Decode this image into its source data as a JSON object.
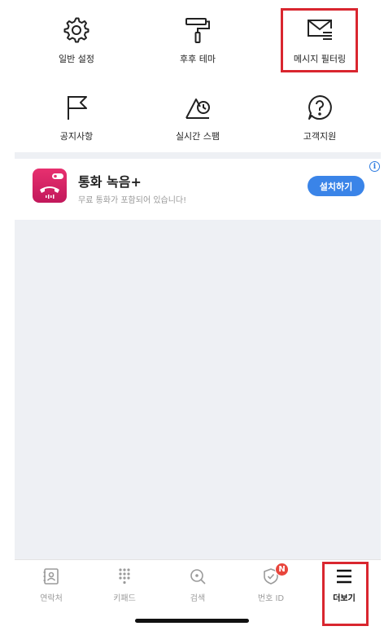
{
  "menu": {
    "items": [
      {
        "label": "일반 설정",
        "icon": "gear-icon"
      },
      {
        "label": "후후 테마",
        "icon": "paint-roller-icon"
      },
      {
        "label": "메시지 필터링",
        "icon": "message-filter-icon"
      },
      {
        "label": "공지사항",
        "icon": "flag-icon"
      },
      {
        "label": "실시간 스팸",
        "icon": "triangle-clock-icon"
      },
      {
        "label": "고객지원",
        "icon": "question-bubble-icon"
      }
    ]
  },
  "ad": {
    "title": "통화 녹음+",
    "subtitle": "무료 통화가 포함되어 있습니다!",
    "install_label": "설치하기",
    "info_label": "i",
    "icon_color": "#d81b60"
  },
  "tabs": [
    {
      "label": "연락처",
      "icon": "contact-book-icon"
    },
    {
      "label": "키패드",
      "icon": "keypad-icon"
    },
    {
      "label": "검색",
      "icon": "search-icon"
    },
    {
      "label": "번호 ID",
      "icon": "shield-id-icon",
      "badge": "N"
    },
    {
      "label": "더보기",
      "icon": "hamburger-menu-icon",
      "active": true
    }
  ],
  "colors": {
    "highlight": "#d9262f",
    "accent": "#3a84e8",
    "badge": "#e8453c",
    "background_gray": "#eef0f4"
  }
}
